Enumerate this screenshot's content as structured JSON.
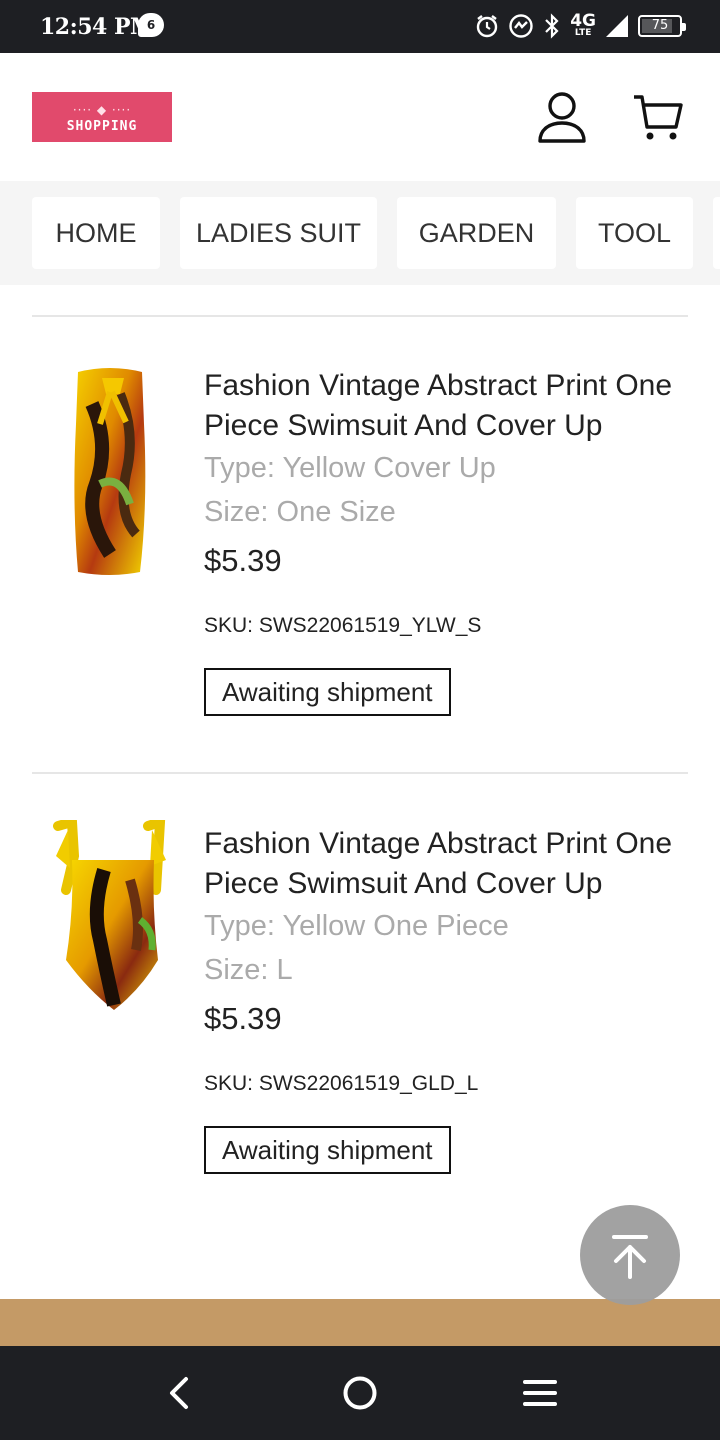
{
  "status_bar": {
    "time": "12:54 PM",
    "notification_count": "6",
    "network": "4G",
    "network_sub": "LTE",
    "battery": "75"
  },
  "header": {
    "logo_text": "SHOPPING",
    "logo_ornament": "···· ◆ ····",
    "brand_color": "#e14a6c"
  },
  "nav": {
    "items": [
      {
        "label": "HOME"
      },
      {
        "label": "LADIES SUIT"
      },
      {
        "label": "GARDEN"
      },
      {
        "label": "TOOL"
      }
    ]
  },
  "orders": [
    {
      "title": "Fashion Vintage Abstract Print One Piece Swimsuit And Cover Up",
      "type_label": "Type: Yellow Cover Up",
      "size_label": "Size: One Size",
      "price": "$5.39",
      "sku": "SKU: SWS22061519_YLW_S",
      "status": "Awaiting shipment",
      "image": "yellow-cover-up"
    },
    {
      "title": "Fashion Vintage Abstract Print One Piece Swimsuit And Cover Up",
      "type_label": "Type: Yellow One Piece",
      "size_label": "Size: L",
      "price": "$5.39",
      "sku": "SKU: SWS22061519_GLD_L",
      "status": "Awaiting shipment",
      "image": "yellow-one-piece-swimsuit"
    }
  ],
  "colors": {
    "footer_strip": "#c49a66",
    "system_bar": "#1e1f23"
  },
  "icons": {
    "user": "user-icon",
    "cart": "cart-icon",
    "back_to_top": "arrow-up-icon",
    "sys_back": "back-icon",
    "sys_home": "home-icon",
    "sys_menu": "menu-icon"
  }
}
